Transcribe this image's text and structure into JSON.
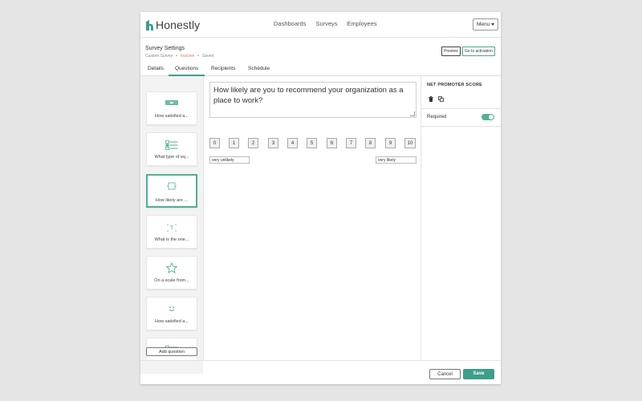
{
  "app": {
    "logo_text": "Honestly",
    "brand_color": "#3d9e8c"
  },
  "topnav": {
    "items": [
      "Dashboards",
      "Surveys",
      "Employees"
    ],
    "menu_label": "Menu"
  },
  "settings": {
    "title": "Survey Settings",
    "type": "Custom Survey",
    "status": "Inactive",
    "save_state": "Saved",
    "preview_label": "Preview",
    "activate_label": "Go to activation"
  },
  "tabs": [
    "Details",
    "Questions",
    "Recipients",
    "Schedule"
  ],
  "active_tab": "Questions",
  "questions": [
    {
      "label": "How satisfied a...",
      "icon": "slider-icon"
    },
    {
      "label": "What type of eq...",
      "icon": "multiple-choice-icon"
    },
    {
      "label": "How likely are ...",
      "icon": "nps-square-icon",
      "active": true
    },
    {
      "label": "What is the one...",
      "icon": "text-icon"
    },
    {
      "label": "On a scale from...",
      "icon": "star-icon"
    },
    {
      "label": "How satisfied a...",
      "icon": "smiley-icon"
    },
    {
      "label": "",
      "icon": "multiple-choice-icon"
    }
  ],
  "add_question_label": "Add question",
  "editor": {
    "question_text": "How likely are you to recommend your organization as a place to work?",
    "scale": [
      "0",
      "1",
      "2",
      "3",
      "4",
      "5",
      "6",
      "7",
      "8",
      "9",
      "10"
    ],
    "low_label": "very unlikely",
    "high_label": "very likely"
  },
  "properties": {
    "title": "NET PROMOTER SCORE",
    "required_label": "Required",
    "required": true
  },
  "footer": {
    "cancel_label": "Cancel",
    "save_label": "Save"
  }
}
